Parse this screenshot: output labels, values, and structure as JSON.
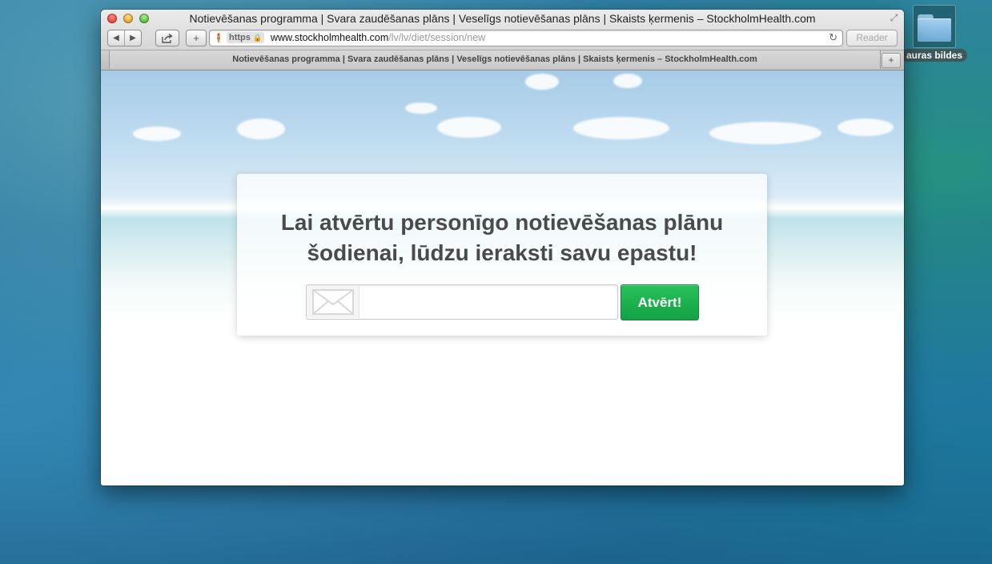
{
  "window": {
    "title": "Notievēšanas programma | Svara zaudēšanas plāns | Veselīgs notievēšanas plāns | Skaists ķermenis – StockholmHealth.com"
  },
  "toolbar": {
    "https_label": "https",
    "url_host": "www.stockholmhealth.com",
    "url_path": "/lv/lv/diet/session/new",
    "reader_label": "Reader",
    "back_icon": "◀",
    "forward_icon": "▶",
    "add_icon": "+",
    "reload_icon": "↻",
    "lock_icon": "🔒"
  },
  "tab": {
    "title": "Notievēšanas programma | Svara zaudēšanas plāns | Veselīgs notievēšanas plāns | Skaists ķermenis – StockholmHealth.com",
    "new_tab_icon": "+"
  },
  "desktop": {
    "folder_label": "auras bildes"
  },
  "card": {
    "title_line1": "Lai atvērtu personīgo notievēšanas plānu",
    "title_line2": "šodienai, lūdzu ieraksti savu epastu!",
    "email_value": "",
    "button_label": "Atvērt!"
  },
  "colors": {
    "button_green": "#1bb04c",
    "title_gray": "#4a4a4a"
  }
}
